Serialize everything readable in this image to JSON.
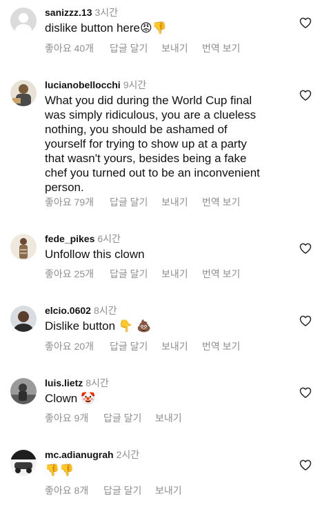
{
  "comments": [
    {
      "username": "sanizzz.13",
      "time": "3시간",
      "text": "dislike button here",
      "emoji": "😡👎",
      "likes": "좋아요 40개",
      "reply": "답글 달기",
      "send": "보내기",
      "translate": "번역 보기"
    },
    {
      "username": "lucianobellocchi",
      "time": "9시간",
      "text": "What you did during the World Cup final\nwas simply ridiculous, you are a clueless\nnothing, you should be ashamed of\nyourself for trying to show up at a party\nthat wasn't yours, besides being a fake\nchef you turned out to be an inconvenient\nperson.",
      "emoji": "",
      "likes": "좋아요 79개",
      "reply": "답글 달기",
      "send": "보내기",
      "translate": "번역 보기"
    },
    {
      "username": "fede_pikes",
      "time": "6시간",
      "text": "Unfollow this clown",
      "emoji": "",
      "likes": "좋아요 25개",
      "reply": "답글 달기",
      "send": "보내기",
      "translate": "번역 보기"
    },
    {
      "username": "elcio.0602",
      "time": "8시간",
      "text": "Dislike button",
      "emoji": "👇 💩",
      "likes": "좋아요 20개",
      "reply": "답글 달기",
      "send": "보내기",
      "translate": "번역 보기"
    },
    {
      "username": "luis.lietz",
      "time": "8시간",
      "text": "Clown",
      "emoji": "🤡",
      "likes": "좋아요 9개",
      "reply": "답글 달기",
      "send": "보내기",
      "translate": ""
    },
    {
      "username": "mc.adianugrah",
      "time": "2시간",
      "text": "",
      "emoji": "👎👎",
      "likes": "좋아요 8개",
      "reply": "답글 달기",
      "send": "보내기",
      "translate": ""
    }
  ],
  "icons": {
    "like": "heart-outline-icon"
  },
  "colors": {
    "text": "#111111",
    "secondary": "#8e8e8e",
    "background": "#ffffff"
  }
}
